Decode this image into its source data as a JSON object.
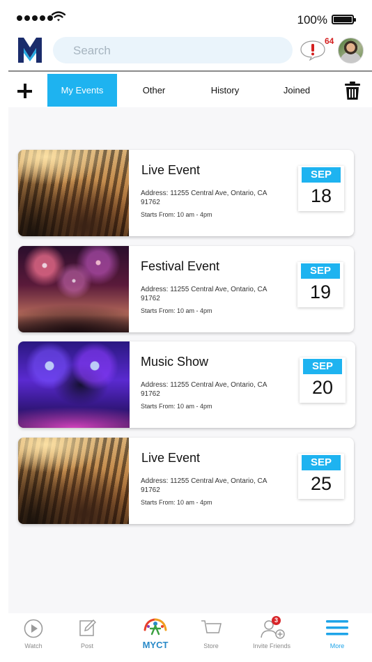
{
  "status_bar": {
    "battery": "100%"
  },
  "header": {
    "search_placeholder": "Search",
    "alert_count": "64"
  },
  "tabs": [
    {
      "label": "My Events",
      "active": true
    },
    {
      "label": "Other",
      "active": false
    },
    {
      "label": "History",
      "active": false
    },
    {
      "label": "Joined",
      "active": false
    }
  ],
  "events": [
    {
      "title": "Live Event",
      "address": "Address: 11255 Central Ave, Ontario, CA 91762",
      "time": "Starts From: 10 am - 4pm",
      "month": "SEP",
      "day": "18",
      "image": "crowd-concert"
    },
    {
      "title": "Festival Event",
      "address": "Address: 11255 Central Ave, Ontario, CA 91762",
      "time": "Starts From: 10 am - 4pm",
      "month": "SEP",
      "day": "19",
      "image": "fireworks"
    },
    {
      "title": "Music Show",
      "address": "Address: 11255 Central Ave, Ontario, CA 91762",
      "time": "Starts From: 10 am - 4pm",
      "month": "SEP",
      "day": "20",
      "image": "dj-stage"
    },
    {
      "title": "Live Event",
      "address": "Address: 11255 Central Ave, Ontario, CA 91762",
      "time": "Starts From: 10 am - 4pm",
      "month": "SEP",
      "day": "25",
      "image": "crowd-concert"
    }
  ],
  "bottom_nav": {
    "watch": "Watch",
    "post": "Post",
    "myct": "MYCT",
    "store": "Store",
    "invite": "Invite Friends",
    "invite_badge": "3",
    "more": "More"
  },
  "colors": {
    "accent": "#1eb3f0",
    "alert_red": "#d42020",
    "logo_navy": "#1a2c6b"
  }
}
